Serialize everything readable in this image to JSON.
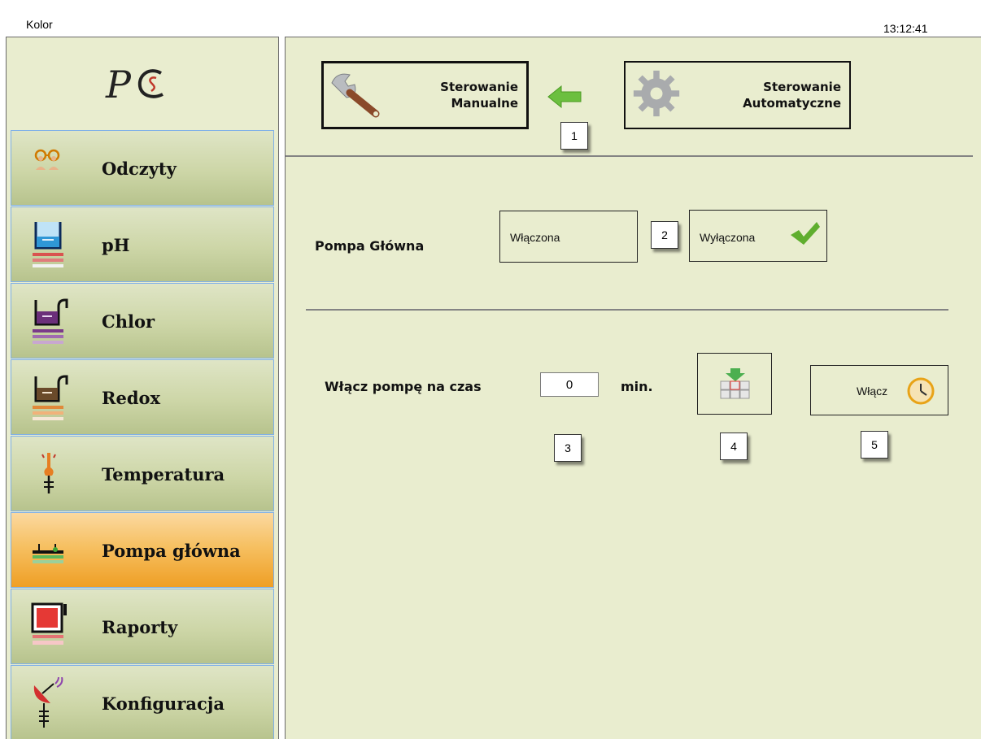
{
  "window": {
    "title": "Kolor",
    "clock": "13:12:41"
  },
  "sidebar": {
    "logo_text": "PCS",
    "items": [
      {
        "label": "Odczyty",
        "icon": "glasses-icon",
        "active": false
      },
      {
        "label": "pH",
        "icon": "ph-beaker-icon",
        "active": false
      },
      {
        "label": "Chlor",
        "icon": "chlorine-beaker-icon",
        "active": false
      },
      {
        "label": "Redox",
        "icon": "redox-beaker-icon",
        "active": false
      },
      {
        "label": "Temperatura",
        "icon": "thermometer-icon",
        "active": false
      },
      {
        "label": "Pompa główna",
        "icon": "pump-icon",
        "active": true
      },
      {
        "label": "Raporty",
        "icon": "report-icon",
        "active": false
      },
      {
        "label": "Konfiguracja",
        "icon": "satellite-dish-icon",
        "active": false
      }
    ]
  },
  "mode": {
    "manual": {
      "line1": "Sterowanie",
      "line2": "Manualne",
      "icon": "wrench-icon"
    },
    "auto": {
      "line1": "Sterowanie",
      "line2": "Automatyczne",
      "icon": "gear-icon"
    },
    "arrow_icon": "arrow-left-icon",
    "badge": "1"
  },
  "pump": {
    "label": "Pompa Główna",
    "on_label": "Włączona",
    "off_label": "Wyłączona",
    "selected": "off",
    "badge": "2"
  },
  "timer": {
    "label": "Włącz pompę na czas",
    "value": "0",
    "unit": "min.",
    "keyboard_icon": "keyboard-icon",
    "start_label": "Włącz",
    "start_icon": "clock-icon",
    "badges": [
      "3",
      "4",
      "5"
    ]
  },
  "colors": {
    "panel": "#e9edcf",
    "menu": "#cdd6a7",
    "active": "#f6c062",
    "accent_green": "#5fae2e"
  }
}
